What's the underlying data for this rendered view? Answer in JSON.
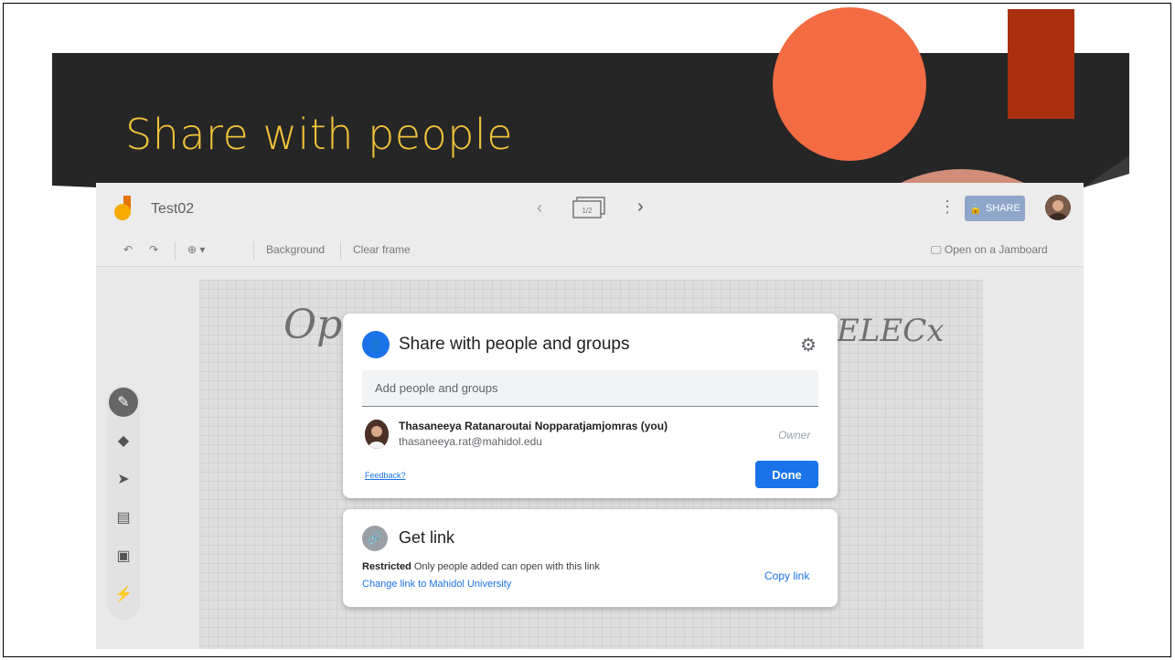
{
  "slide": {
    "title": "Share with people"
  },
  "app": {
    "doc_title": "Test02",
    "frame_counter": "1/2",
    "share_label": "SHARE",
    "toolbar": {
      "background_label": "Background",
      "clear_frame_label": "Clear frame",
      "open_on_jamboard_label": "Open on a Jamboard"
    },
    "handwriting_left": "Ope",
    "handwriting_right": "ELECx"
  },
  "share_dialog": {
    "title": "Share with people and groups",
    "add_placeholder": "Add people and groups",
    "person": {
      "name": "Thasaneeya Ratanaroutai Nopparatjamjomras (you)",
      "email": "thasaneeya.rat@mahidol.edu",
      "role": "Owner"
    },
    "feedback_label": "Feedback?",
    "done_label": "Done"
  },
  "link_dialog": {
    "title": "Get link",
    "restricted_label": "Restricted",
    "description": "Only people added can open with this link",
    "change_link_label": "Change link to Mahidol University",
    "copy_link_label": "Copy link"
  },
  "colors": {
    "title": "#f2c23a",
    "banner": "#2a2a2a",
    "circle_orange": "#f26b43",
    "rect_red": "#a8300f",
    "primary_blue": "#1a73e8"
  }
}
